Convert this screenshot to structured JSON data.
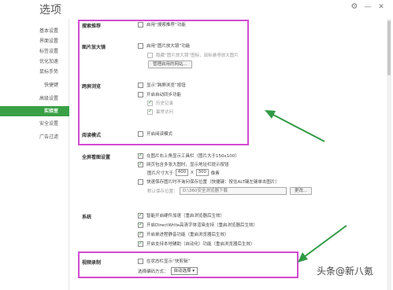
{
  "window": {
    "title": "选项"
  },
  "sidebar": {
    "items": [
      {
        "label": "基本设置"
      },
      {
        "label": "界面设置"
      },
      {
        "label": "标签设置"
      },
      {
        "label": "优化加速"
      },
      {
        "label": "鼠标手势"
      },
      {
        "label": "快捷键"
      },
      {
        "label": "高级设置"
      },
      {
        "label": "实验室"
      },
      {
        "label": "安全设置"
      },
      {
        "label": "广告过滤"
      }
    ],
    "active_index": 7
  },
  "sections": {
    "search": {
      "title": "搜索推荐",
      "opt1": "启用“搜索推荐”功能"
    },
    "zoom": {
      "title": "图片放大镜",
      "opt1": "启用“图片放大镜”功能",
      "opt2": "隐藏“图片放大镜”图标，鼠标悬停放大图片",
      "manage_btn": "管理启用的网站..."
    },
    "cross": {
      "title": "跨屏浏览",
      "opt1": "显示“跨屏浏览”按钮",
      "opt2": "开启自动同步功能",
      "opt3": "历史记录",
      "opt4": "最常访问"
    },
    "reading": {
      "title": "阅读模式",
      "opt1": "开启阅读模式"
    },
    "image_settings": {
      "title": "全屏看图设置",
      "opt1": "在图片右上角显示工具栏（图片大于150x100）",
      "opt2": "网页包含多张大图时，显示地址栏提示按钮",
      "size_label": "图片尺寸大于",
      "size_w": "400",
      "size_x": "X",
      "size_h": "300",
      "size_unit": "像素",
      "opt3": "快速保存图片时不询问保存位置（快捷键：按住ALT键左键单击图片）",
      "save_label": "默认保存位置：",
      "save_path": "D:\\360安全浏览器下载",
      "browse_btn": "更改..."
    },
    "system": {
      "title": "系统",
      "opt1": "智能开启硬件加速（重启浏览器后生效）",
      "opt2": "开启DirectWrite高清字体渲染支持（重启浏览器后生效）",
      "opt3": "开启单进程静音功能（重启浏览器后生效）",
      "opt4": "开启支持本地辅助（自动化）功能（重启浏览器后生效）"
    },
    "video": {
      "title": "视频录制",
      "opt1": "在状态栏显示“快剪辑”",
      "encode_label": "选择编码方式：",
      "encode_value": "自动选择"
    }
  },
  "watermark": "头条@新八氪",
  "colors": {
    "accent": "#3aa046",
    "highlight": "#d24bd2",
    "arrow": "#2f9a46"
  },
  "icons": [
    "settings-icon",
    "minimize-icon",
    "close-icon",
    "checkbox-icon",
    "dropdown-arrow-icon",
    "arrow-annotation"
  ]
}
